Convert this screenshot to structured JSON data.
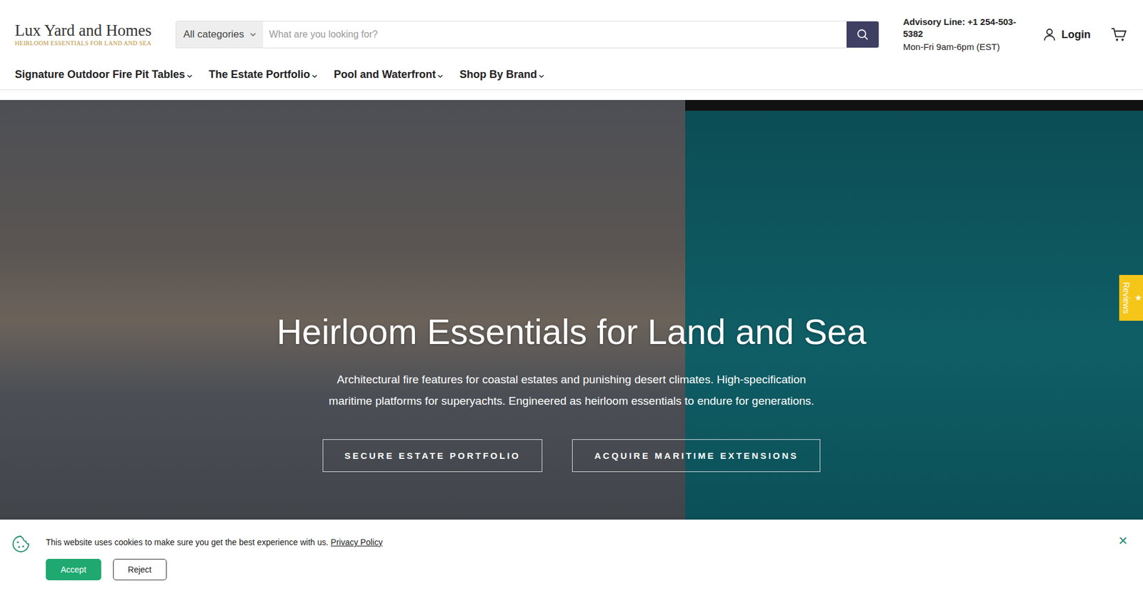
{
  "header": {
    "logo": {
      "title": "Lux Yard and Homes",
      "tagline": "HEIRLOOM ESSENTIALS FOR LAND AND SEA"
    },
    "search": {
      "category": "All categories",
      "placeholder": "What are you looking for?"
    },
    "advisory": {
      "line": "Advisory Line: +1 254-503-5382",
      "hours": "Mon-Fri 9am-6pm (EST)"
    },
    "login": "Login"
  },
  "nav": [
    {
      "label": "Signature Outdoor Fire Pit Tables"
    },
    {
      "label": "The Estate Portfolio"
    },
    {
      "label": "Pool and Waterfront"
    },
    {
      "label": "Shop By Brand"
    }
  ],
  "hero": {
    "title": "Heirloom Essentials for Land and Sea",
    "text": "Architectural fire features for coastal estates and punishing desert climates. High-specification maritime platforms for superyachts. Engineered as heirloom essentials to endure for generations.",
    "buttons": [
      "SECURE ESTATE PORTFOLIO",
      "ACQUIRE MARITIME EXTENSIONS"
    ]
  },
  "reviews_tab": {
    "icon": "★",
    "label": "Reviews"
  },
  "cookie_banner": {
    "text": "This website uses cookies to make sure you get the best experience with us.",
    "link": "Privacy Policy",
    "buttons": [
      "Accept",
      "Reject"
    ],
    "close": "×"
  }
}
